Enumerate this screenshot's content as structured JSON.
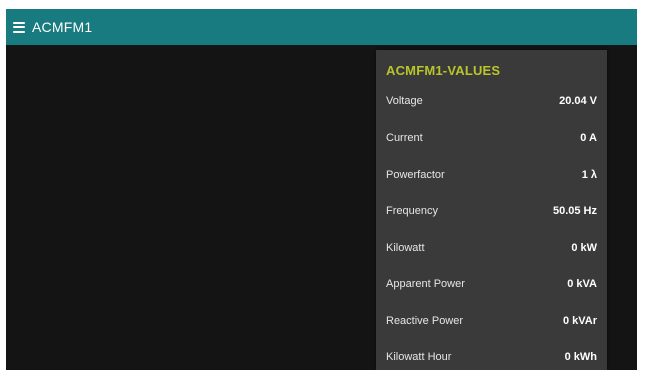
{
  "header": {
    "title": "ACMFM1",
    "menu_icon": "hamburger-menu-icon",
    "background_color": "#177b7f"
  },
  "panel": {
    "title": "ACMFM1-VALUES",
    "title_color": "#b9c52a",
    "rows": [
      {
        "label": "Voltage",
        "value": "20.04 V"
      },
      {
        "label": "Current",
        "value": "0 A"
      },
      {
        "label": "Powerfactor",
        "value": "1 λ"
      },
      {
        "label": "Frequency",
        "value": "50.05 Hz"
      },
      {
        "label": "Kilowatt",
        "value": "0 kW"
      },
      {
        "label": "Apparent Power",
        "value": "0 kVA"
      },
      {
        "label": "Reactive Power",
        "value": "0 kVAr"
      },
      {
        "label": "Kilowatt Hour",
        "value": "0 kWh"
      }
    ]
  }
}
